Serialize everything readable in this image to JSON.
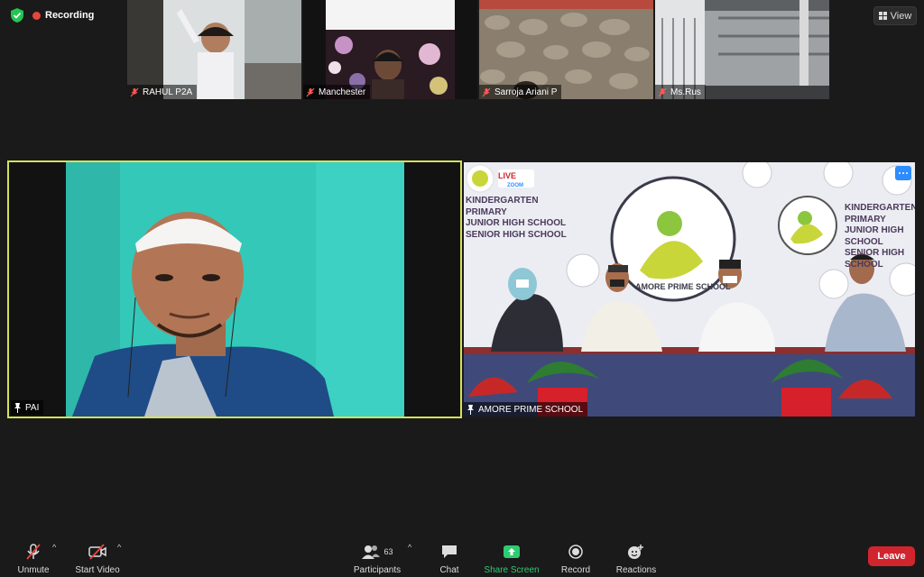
{
  "status": {
    "recording_label": "Recording",
    "view_label": "View"
  },
  "thumbnails": [
    {
      "name": "RAHUL P2A"
    },
    {
      "name": "Manchester"
    },
    {
      "name": "Sarroja Ariani P"
    },
    {
      "name": "Ms.Rus"
    }
  ],
  "main_tiles": {
    "left_name": "PAI",
    "right_name": "AMORE PRIME SCHOOL",
    "banner": {
      "line1": "KINDERGARTEN",
      "line2": "PRIMARY",
      "line3": "JUNIOR HIGH SCHOOL",
      "line4": "SENIOR HIGH SCHOOL",
      "logo_text": "AMORE PRIME SCHOOL",
      "live_badge": "LIVE",
      "live_sub": "ZOOM"
    }
  },
  "toolbar": {
    "unmute": "Unmute",
    "start_video": "Start Video",
    "participants": "Participants",
    "participants_count": "63",
    "chat": "Chat",
    "share_screen": "Share Screen",
    "record": "Record",
    "reactions": "Reactions",
    "leave": "Leave"
  },
  "colors": {
    "active_speaker_border": "#d4e157",
    "share_screen": "#2ecc71",
    "leave": "#d0252f",
    "recording_dot": "#e8453c",
    "more_button": "#2d8cff"
  }
}
